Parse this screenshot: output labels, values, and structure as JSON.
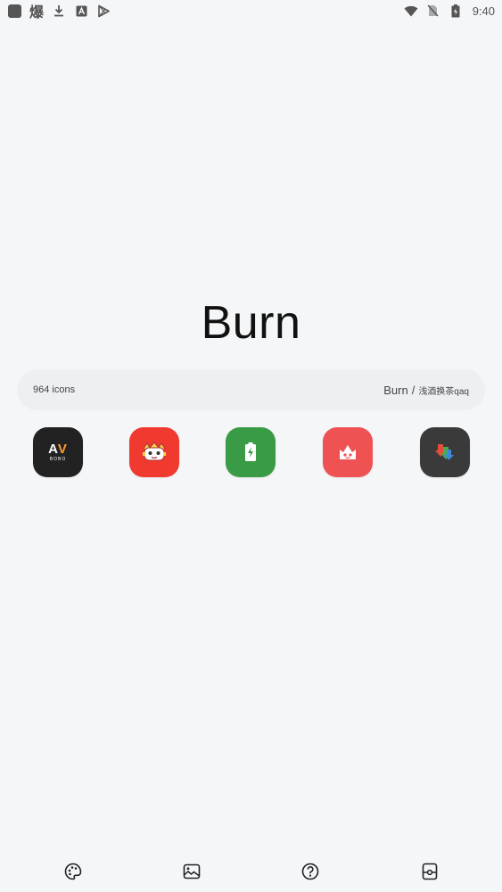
{
  "status_bar": {
    "left_icons": [
      "app-square-icon",
      "bao-char-icon",
      "download-icon",
      "a-box-icon",
      "play-store-icon"
    ],
    "bao_char": "爆",
    "time": "9:40",
    "right_icons": [
      "wifi-icon",
      "no-sim-icon",
      "battery-icon"
    ]
  },
  "header": {
    "title": "Burn"
  },
  "info": {
    "icon_count": "964 icons",
    "theme_name": "Burn",
    "separator": "/",
    "author": "浅酒换茶qaq"
  },
  "apps": [
    {
      "name": "AV BOBO",
      "main_a": "A",
      "main_v": "V",
      "sub": "BOBO",
      "bg": "#222222"
    },
    {
      "name": "comic app",
      "bg": "#f0392f"
    },
    {
      "name": "battery app",
      "bg": "#3a9b46"
    },
    {
      "name": "crown app",
      "bg": "#ee5252"
    },
    {
      "name": "download app",
      "bg": "#3a3a3a"
    }
  ],
  "bottom_nav": {
    "items": [
      "palette-icon",
      "wallpaper-icon",
      "help-icon",
      "apply-icon"
    ]
  },
  "colors": {
    "background": "#f5f6f8",
    "pill": "#eeeff1",
    "text": "#111111"
  }
}
